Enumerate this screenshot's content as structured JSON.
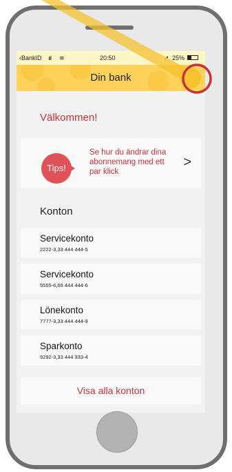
{
  "status": {
    "carrier": "BankID",
    "time": "20:50",
    "battery": "25%"
  },
  "nav": {
    "title": "Din bank"
  },
  "welcome": "Välkommen!",
  "tips": {
    "badge": "Tips!",
    "line1": "Se hur du ändrar dina",
    "line2": "abonnemang med ett",
    "line3": "par klick"
  },
  "accounts": {
    "heading": "Konton",
    "items": [
      {
        "name": "Servicekonto",
        "number": "2222-3,33 444 444-5"
      },
      {
        "name": "Servicekonto",
        "number": "5555-6,66 444 444-6"
      },
      {
        "name": "Lönekonto",
        "number": "7777-3,33 444 444-9"
      },
      {
        "name": "Sparkonto",
        "number": "9292-3,33 444 333-4"
      }
    ],
    "show_all": "Visa alla konton"
  },
  "colors": {
    "accent": "#c8323a",
    "navbar": "#fdd25a",
    "highlight_ring": "#c8323a",
    "spotlight": "#f6c230"
  }
}
